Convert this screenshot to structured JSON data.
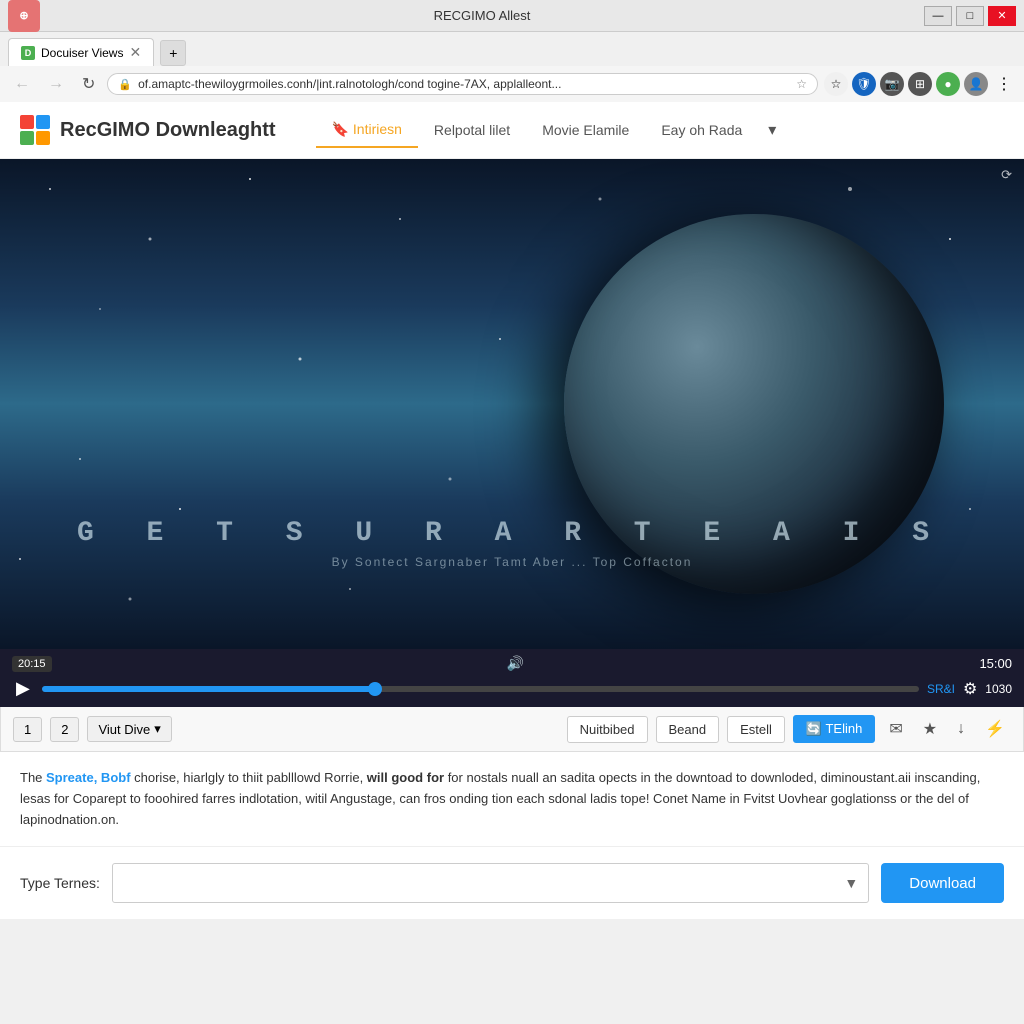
{
  "window": {
    "title": "RECGIMO Allest",
    "tab_label": "Docuiser Views",
    "favicon_letter": "D"
  },
  "browser": {
    "address": "of.amaptc-thewiloygrmoiles.conh/|int.ralnotologh/cond togine-7AX, applalleont...",
    "back_btn": "←",
    "forward_btn": "→",
    "refresh_btn": "↻"
  },
  "app": {
    "logo_text": "RecGIMO Downleaghtt",
    "nav": {
      "items": [
        {
          "label": "🔖 Intiriesn",
          "active": true
        },
        {
          "label": "Relpotal lilet",
          "active": false
        },
        {
          "label": "Movie Elamile",
          "active": false
        },
        {
          "label": "Eay oh Rada",
          "active": false
        }
      ]
    }
  },
  "video": {
    "title_text": "G E T S   U R   A R T E A   I S",
    "subtitle_text": "By Sontect Sargnaber Tamt Aber ...   Top Coffacton",
    "clock": "⟳",
    "time_badge": "20:15",
    "volume_icon": "🔊",
    "duration": "15:00",
    "play_icon": "▶",
    "progress_percent": 38,
    "quality": "SR&I",
    "settings_icon": "⚙",
    "resolution": "1030"
  },
  "action_bar": {
    "num1": "1",
    "num2": "2",
    "view_dropdown": "Viut Dive",
    "btn_nuitbibed": "Nuitbibed",
    "btn_beand": "Beand",
    "btn_estell": "Estell",
    "btn_telinh": "🔄 TElinh",
    "icon_email": "✉",
    "icon_star": "★",
    "icon_download": "↓",
    "icon_flash": "⚡"
  },
  "description": {
    "text1": "The ",
    "highlight1": "Spreate, Bobf",
    "text2": " chorise, hiarlgly to thiit pablllowd Rorrie,",
    "bold1": " will good for",
    "text3": " for nostals nuall an sadita opects in the downtoad to downloded, diminoustant.aii inscanding, lesas for Coparept to fooohired farres indlotation, witil Angustage, can fros onding tion each sdonal ladis tope! Conet Name in Fvitst Uovhear goglationss or the del of lapinodnation.on."
  },
  "download_section": {
    "type_label": "Type Ternes:",
    "input_placeholder": "",
    "input_icon": "▼",
    "download_btn": "Download"
  }
}
